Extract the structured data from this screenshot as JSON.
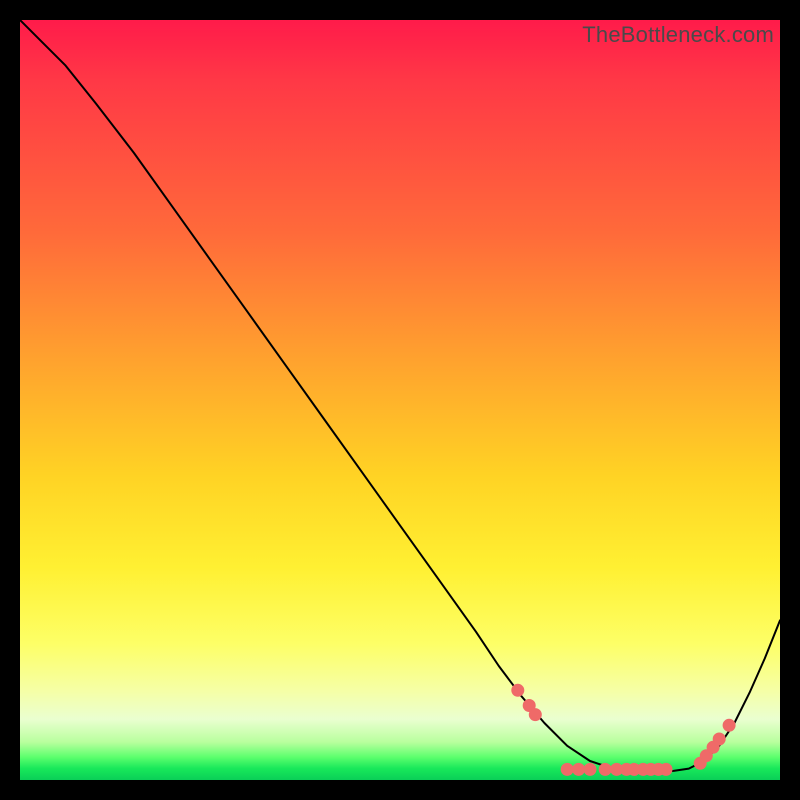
{
  "watermark": "TheBottleneck.com",
  "colors": {
    "curve": "#000000",
    "marker_fill": "#ef6a68",
    "marker_stroke": "#ef6a68"
  },
  "chart_data": {
    "type": "line",
    "title": "",
    "xlabel": "",
    "ylabel": "",
    "xlim": [
      0,
      100
    ],
    "ylim": [
      0,
      100
    ],
    "grid": false,
    "legend": false,
    "series": [
      {
        "name": "curve",
        "x": [
          0,
          3,
          6,
          10,
          15,
          20,
          25,
          30,
          35,
          40,
          45,
          50,
          55,
          60,
          63,
          66,
          69,
          72,
          75,
          78,
          80,
          83,
          86,
          88,
          90,
          92,
          94,
          96,
          98,
          100
        ],
        "y": [
          100,
          97,
          94,
          89,
          82.5,
          75.5,
          68.5,
          61.5,
          54.5,
          47.5,
          40.5,
          33.5,
          26.5,
          19.5,
          15,
          11,
          7.5,
          4.5,
          2.5,
          1.5,
          1.2,
          1.1,
          1.2,
          1.5,
          2.5,
          4.5,
          7.5,
          11.5,
          16,
          21
        ]
      }
    ],
    "markers": [
      {
        "x": 65.5,
        "y": 11.8
      },
      {
        "x": 67.0,
        "y": 9.8
      },
      {
        "x": 67.8,
        "y": 8.6
      },
      {
        "x": 72.0,
        "y": 1.4
      },
      {
        "x": 73.5,
        "y": 1.4
      },
      {
        "x": 75.0,
        "y": 1.4
      },
      {
        "x": 77.0,
        "y": 1.4
      },
      {
        "x": 78.5,
        "y": 1.4
      },
      {
        "x": 79.8,
        "y": 1.4
      },
      {
        "x": 80.8,
        "y": 1.4
      },
      {
        "x": 82.0,
        "y": 1.4
      },
      {
        "x": 83.0,
        "y": 1.4
      },
      {
        "x": 84.0,
        "y": 1.4
      },
      {
        "x": 85.0,
        "y": 1.4
      },
      {
        "x": 89.5,
        "y": 2.2
      },
      {
        "x": 90.3,
        "y": 3.2
      },
      {
        "x": 91.2,
        "y": 4.3
      },
      {
        "x": 92.0,
        "y": 5.4
      },
      {
        "x": 93.3,
        "y": 7.2
      }
    ]
  }
}
